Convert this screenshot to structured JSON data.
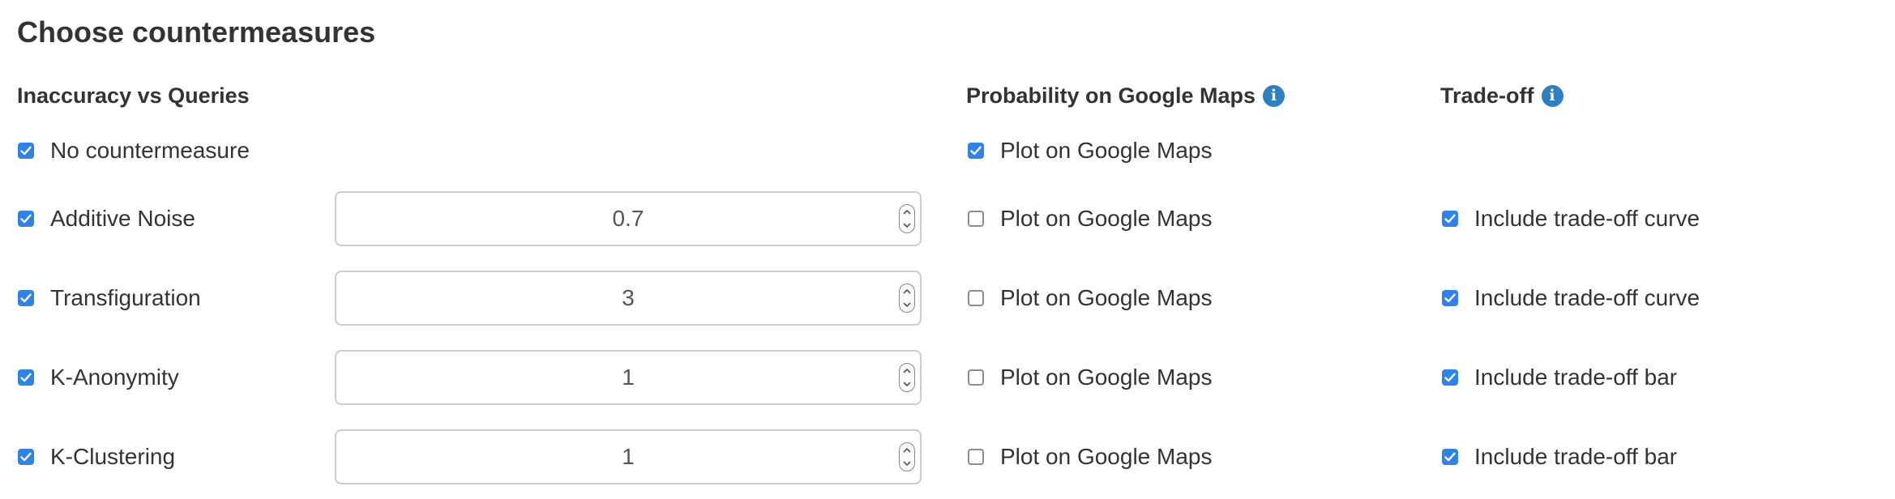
{
  "title": "Choose countermeasures",
  "headers": {
    "inaccuracy": "Inaccuracy vs Queries",
    "probability": "Probability on Google Maps",
    "tradeoff": "Trade-off",
    "info_icon_glyph": "i"
  },
  "colors": {
    "checkbox_checked": "#2f82e8",
    "info_icon": "#2f7ec0"
  },
  "rows": [
    {
      "countermeasure": {
        "label": "No countermeasure",
        "checked": true
      },
      "maps": {
        "label": "Plot on Google Maps",
        "checked": true
      }
    },
    {
      "countermeasure": {
        "label": "Additive Noise",
        "checked": true
      },
      "value": "0.7",
      "maps": {
        "label": "Plot on Google Maps",
        "checked": false
      },
      "tradeoff": {
        "label": "Include trade-off curve",
        "checked": true
      }
    },
    {
      "countermeasure": {
        "label": "Transfiguration",
        "checked": true
      },
      "value": "3",
      "maps": {
        "label": "Plot on Google Maps",
        "checked": false
      },
      "tradeoff": {
        "label": "Include trade-off curve",
        "checked": true
      }
    },
    {
      "countermeasure": {
        "label": "K-Anonymity",
        "checked": true
      },
      "value": "1",
      "maps": {
        "label": "Plot on Google Maps",
        "checked": false
      },
      "tradeoff": {
        "label": "Include trade-off bar",
        "checked": true
      }
    },
    {
      "countermeasure": {
        "label": "K-Clustering",
        "checked": true
      },
      "value": "1",
      "maps": {
        "label": "Plot on Google Maps",
        "checked": false
      },
      "tradeoff": {
        "label": "Include trade-off bar",
        "checked": true
      }
    }
  ]
}
